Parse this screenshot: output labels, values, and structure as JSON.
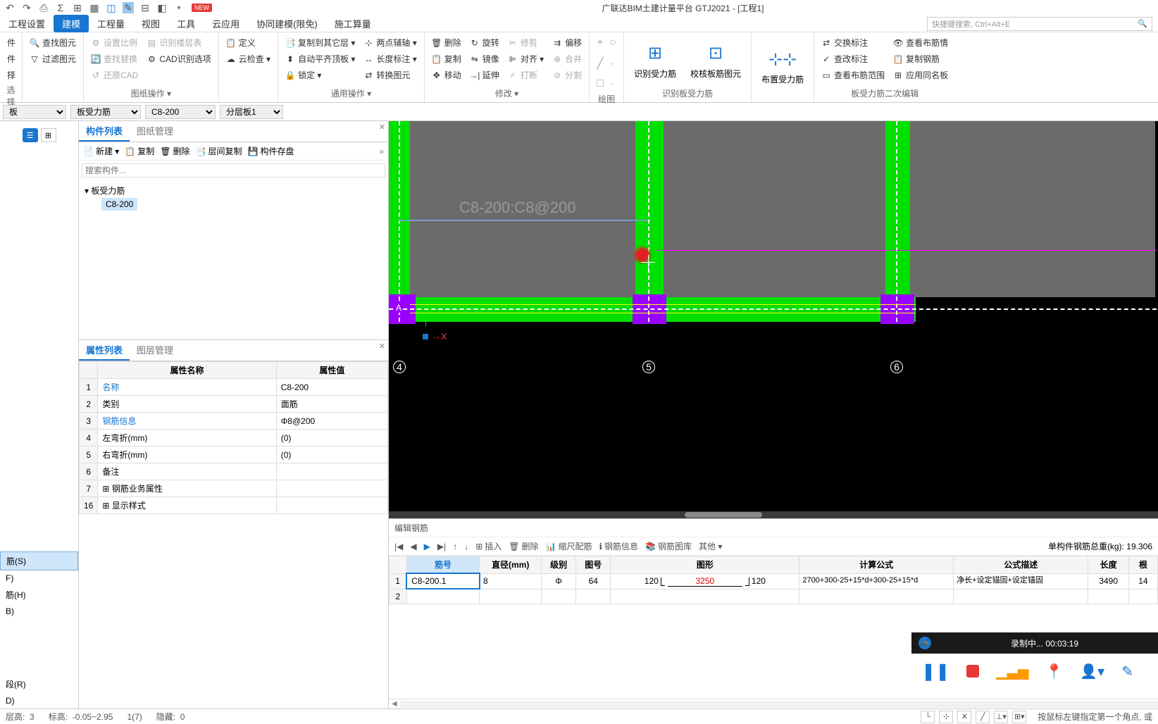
{
  "titlebar": {
    "new_badge": "NEW",
    "title": "广联达BIM土建计量平台 GTJ2021 - [工程1]"
  },
  "menubar": {
    "items": [
      "工程设置",
      "建模",
      "工程量",
      "视图",
      "工具",
      "云应用",
      "协同建模(限免)",
      "施工算量"
    ],
    "active_index": 1,
    "search_placeholder": "快捷键搜索, Ctrl+Alt+E"
  },
  "ribbon": {
    "group0": {
      "label": "选择",
      "items": [
        "件",
        "件",
        "择"
      ]
    },
    "group1": {
      "label": "",
      "items": [
        "查找图元",
        "过滤图元"
      ]
    },
    "group2": {
      "label": "图纸操作 ▾",
      "items": [
        "设置比例",
        "查找替换",
        "还原CAD",
        "识别楼层表",
        "CAD识别选项"
      ]
    },
    "group3": {
      "label": "",
      "items": [
        "定义",
        "云检查 ▾"
      ]
    },
    "group4": {
      "label": "通用操作 ▾",
      "items": [
        "复制到其它层 ▾",
        "自动平齐顶板 ▾",
        "锁定 ▾",
        "两点辅轴 ▾",
        "长度标注 ▾",
        "转换图元"
      ]
    },
    "group5": {
      "label": "修改 ▾",
      "items": [
        "删除",
        "复制",
        "移动",
        "旋转",
        "镜像",
        "延伸",
        "修剪",
        "对齐 ▾",
        "打断",
        "偏移",
        "合并",
        "分割"
      ]
    },
    "group6": {
      "label": "绘图",
      "items": [
        "+",
        "○"
      ]
    },
    "group7": {
      "label": "识别板受力筋",
      "items": [
        "识别受力筋",
        "校核板筋图元"
      ]
    },
    "group8": {
      "label": "",
      "big_label": "布置受力筋"
    },
    "group9": {
      "label": "板受力筋二次编辑",
      "items": [
        "交换标注",
        "查改标注",
        "查看布筋范围",
        "查看布筋情",
        "复制钢筋",
        "应用同名板"
      ]
    }
  },
  "selectors": {
    "s1": "板",
    "s2": "板受力筋",
    "s3": "C8-200",
    "s4": "分层板1"
  },
  "left_panel": {
    "items_bottom": [
      "筋(S)",
      "F)",
      "筋(H)",
      "B)",
      "",
      "段(R)",
      "D)"
    ]
  },
  "component_list": {
    "tabs": [
      "构件列表",
      "图纸管理"
    ],
    "active_tab": 0,
    "toolbar": [
      "新建 ▾",
      "复制",
      "删除",
      "层间复制",
      "构件存盘"
    ],
    "search_placeholder": "搜索构件...",
    "tree_parent": "板受力筋",
    "tree_child": "C8-200"
  },
  "property_list": {
    "tabs": [
      "属性列表",
      "图层管理"
    ],
    "active_tab": 0,
    "headers": [
      "属性名称",
      "属性值"
    ],
    "rows": [
      {
        "num": "1",
        "name": "名称",
        "value": "C8-200",
        "blue": true
      },
      {
        "num": "2",
        "name": "类别",
        "value": "面筋",
        "blue": false
      },
      {
        "num": "3",
        "name": "钢筋信息",
        "value": "Φ8@200",
        "blue": true
      },
      {
        "num": "4",
        "name": "左弯折(mm)",
        "value": "(0)",
        "blue": false
      },
      {
        "num": "5",
        "name": "右弯折(mm)",
        "value": "(0)",
        "blue": false
      },
      {
        "num": "6",
        "name": "备注",
        "value": "",
        "blue": false
      },
      {
        "num": "7",
        "name": "⊞ 钢筋业务属性",
        "value": "",
        "blue": false
      },
      {
        "num": "16",
        "name": "⊞ 显示样式",
        "value": "",
        "blue": false
      }
    ]
  },
  "viewport": {
    "label": "C8-200:C8@200",
    "axis_labels": [
      "4",
      "5",
      "6"
    ],
    "axis_a": "A",
    "x_label": "X"
  },
  "rebar_editor": {
    "title": "编辑钢筋",
    "toolbar": [
      "插入",
      "删除",
      "缩尺配筋",
      "钢筋信息",
      "钢筋图库",
      "其他 ▾"
    ],
    "total_label": "单构件钢筋总重(kg):",
    "total_value": "19.306",
    "headers": [
      "筋号",
      "直径(mm)",
      "级别",
      "图号",
      "图形",
      "计算公式",
      "公式描述",
      "长度",
      "根"
    ],
    "row": {
      "num": "1",
      "id": "C8-200.1",
      "diameter": "8",
      "grade": "Φ",
      "figno": "64",
      "shape_left": "120",
      "shape_mid": "3250",
      "shape_right": "120",
      "formula": "2700+300-25+15*d+300-25+15*d",
      "desc": "净长+设定锚固+设定锚固",
      "length": "3490",
      "count": "14"
    },
    "row2_num": "2"
  },
  "statusbar": {
    "floor_label": "层高:",
    "floor_value": "3",
    "elev_label": "标高:",
    "elev_value": "-0.05~2.95",
    "count": "1(7)",
    "hidden_label": "隐藏:",
    "hidden_value": "0",
    "hint": "按鼠标左键指定第一个角点, 或"
  },
  "recording": {
    "status": "录制中...",
    "time": "00:03:19"
  }
}
